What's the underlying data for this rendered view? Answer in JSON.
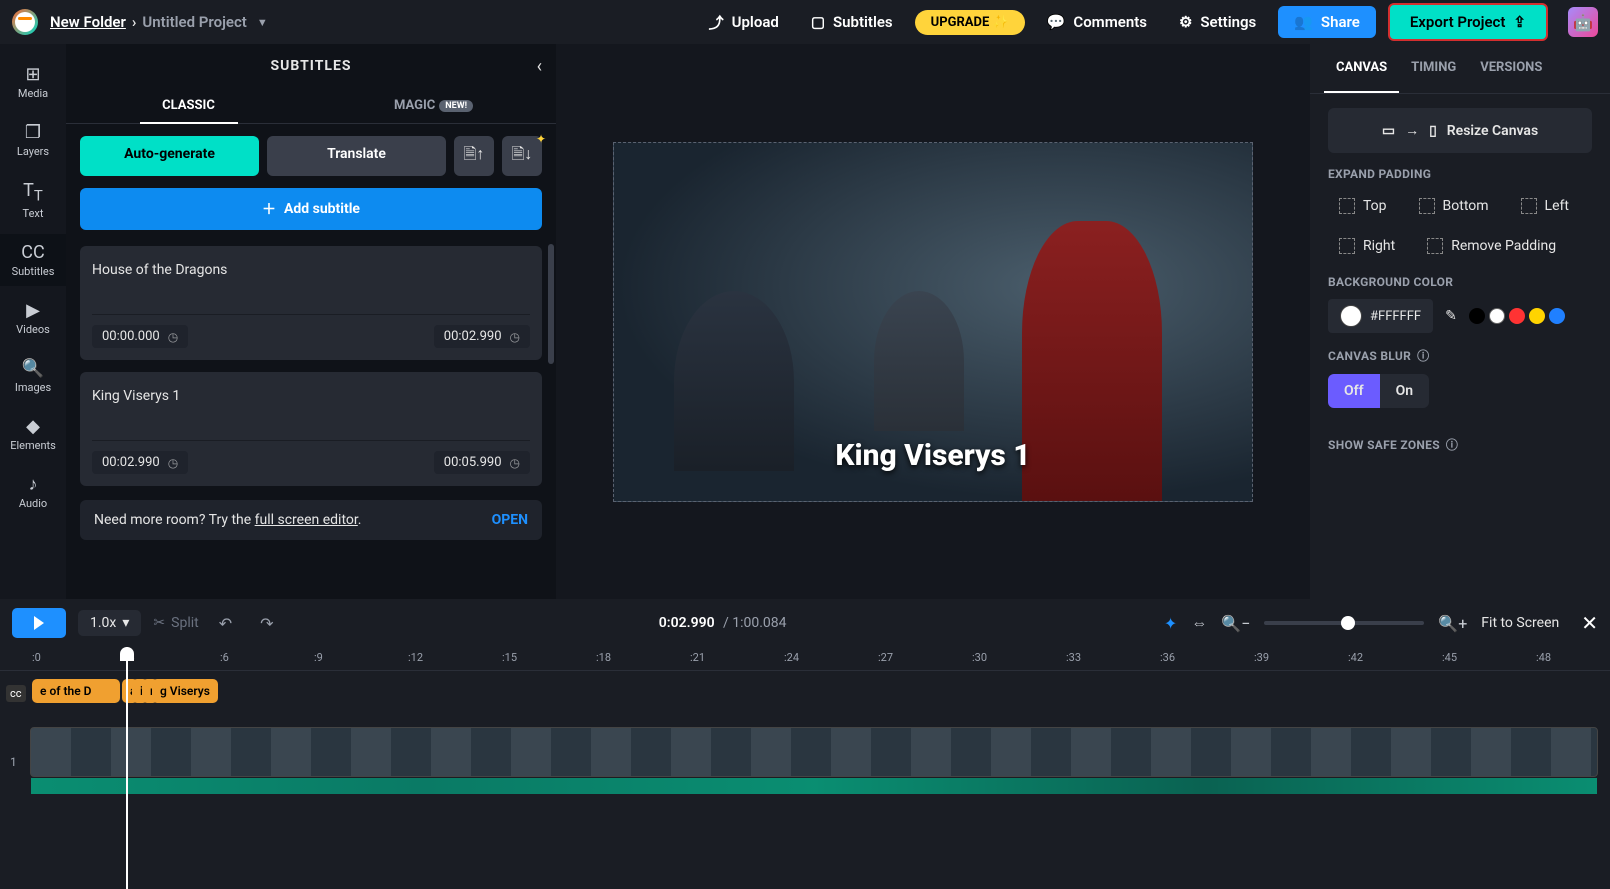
{
  "breadcrumb": {
    "folder": "New Folder",
    "project": "Untitled Project"
  },
  "topbar": {
    "upload": "Upload",
    "subtitles": "Subtitles",
    "upgrade": "UPGRADE ✨",
    "comments": "Comments",
    "settings": "Settings",
    "share": "Share",
    "export": "Export Project"
  },
  "rail": {
    "media": "Media",
    "layers": "Layers",
    "text": "Text",
    "subtitles": "Subtitles",
    "videos": "Videos",
    "images": "Images",
    "elements": "Elements",
    "audio": "Audio"
  },
  "left_panel": {
    "title": "SUBTITLES",
    "tab_classic": "CLASSIC",
    "tab_magic": "MAGIC",
    "badge_new": "NEW!",
    "auto_generate": "Auto-generate",
    "translate": "Translate",
    "add_subtitle": "Add subtitle",
    "entries": [
      {
        "text": "House of the Dragons",
        "start": "00:00.000",
        "end": "00:02.990"
      },
      {
        "text": "King Viserys 1",
        "start": "00:02.990",
        "end": "00:05.990"
      }
    ],
    "roombar_prefix": "Need more room? Try the ",
    "roombar_link": "full screen editor",
    "roombar_suffix": ".",
    "open": "OPEN"
  },
  "canvas": {
    "subtitle_overlay": "King Viserys 1"
  },
  "right_panel": {
    "tabs": {
      "canvas": "CANVAS",
      "timing": "TIMING",
      "versions": "VERSIONS"
    },
    "resize": "Resize Canvas",
    "expand_padding": "EXPAND PADDING",
    "pad": {
      "top": "Top",
      "bottom": "Bottom",
      "left": "Left",
      "right": "Right",
      "remove": "Remove Padding"
    },
    "bg_label": "BACKGROUND COLOR",
    "bg_hex": "#FFFFFF",
    "swatches": [
      "#000000",
      "#FFFFFF",
      "#FF3333",
      "#FFD400",
      "#2080FF"
    ],
    "blur_label": "CANVAS BLUR",
    "blur_off": "Off",
    "blur_on": "On",
    "safe_zones": "SHOW SAFE ZONES"
  },
  "timeline_controls": {
    "speed": "1.0x",
    "split": "Split",
    "current": "0:02.990",
    "duration": "1:00.084",
    "fit": "Fit to Screen"
  },
  "ruler": [
    ":0",
    ":3",
    ":6",
    ":9",
    ":12",
    ":15",
    ":18",
    ":21",
    ":24",
    ":27",
    ":30",
    ":33",
    ":36",
    ":39",
    ":42",
    ":45",
    ":48"
  ],
  "timeline_chips": [
    "e of the D",
    "a",
    "i",
    "r",
    "g Viserys"
  ]
}
